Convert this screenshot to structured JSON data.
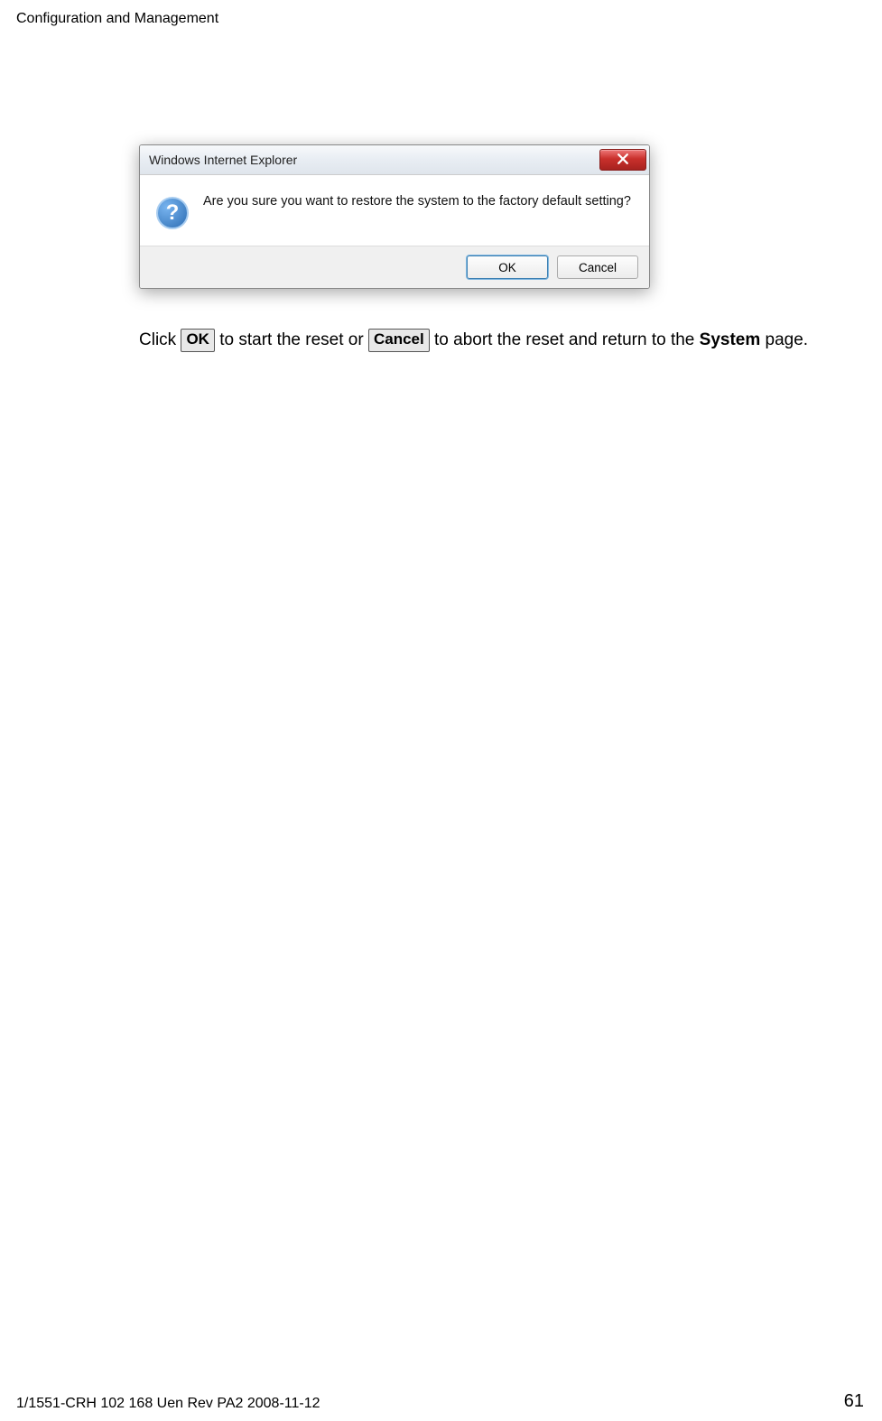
{
  "header": {
    "section_title": "Configuration and Management"
  },
  "dialog": {
    "title": "Windows Internet Explorer",
    "message": "Are you sure you want to restore the system to the factory default setting?",
    "ok_label": "OK",
    "cancel_label": "Cancel",
    "question_glyph": "?"
  },
  "body": {
    "sentence_pre": "Click ",
    "btn_ok": "OK",
    "sentence_mid": " to start the reset or ",
    "btn_cancel": "Cancel",
    "sentence_post": " to abort the reset and return to the ",
    "system_word": "System",
    "sentence_end": " page."
  },
  "footer": {
    "left": "1/1551-CRH 102 168 Uen Rev PA2  2008-11-12",
    "page_number": "61"
  }
}
